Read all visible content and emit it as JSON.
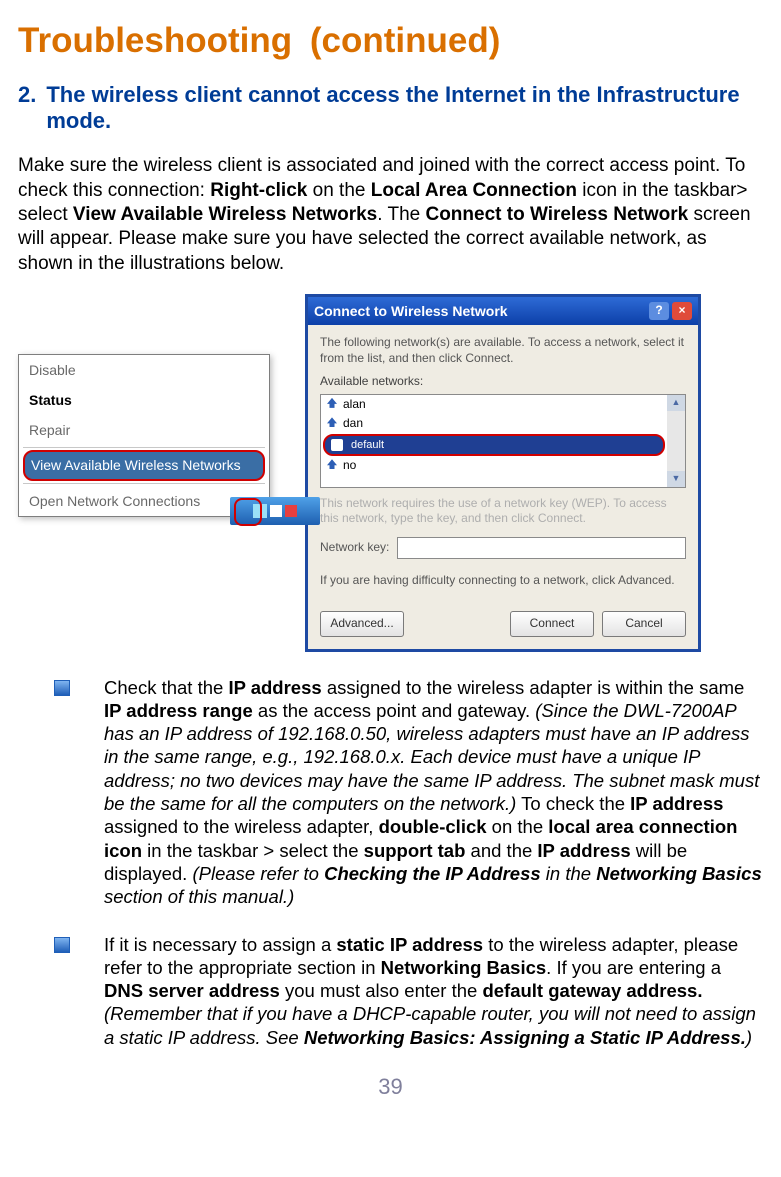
{
  "title": "Troubleshooting (continued)",
  "step": {
    "num": "2.",
    "heading": "The wireless client cannot access the Internet in the Infrastructure mode."
  },
  "intro": {
    "t1": "Make sure the wireless client is associated and joined with the correct access point. To check this connection: ",
    "b1": "Right-click",
    "t2": " on the ",
    "b2": "Local Area Connection",
    "t3": " icon in the taskbar> select ",
    "b3": "View Available Wireless Networks",
    "t4": ". The ",
    "b4": "Connect to Wireless Network",
    "t5": " screen will appear. Please make sure you have selected the correct available network, as shown in the illustrations below."
  },
  "context_menu": {
    "items": [
      "Disable",
      "Status",
      "Repair"
    ],
    "highlight": "View Available Wireless Networks",
    "last": "Open Network Connections"
  },
  "dialog": {
    "title": "Connect to Wireless Network",
    "desc": "The following network(s) are available. To access a network, select it from the list, and then click Connect.",
    "avail_label": "Available networks:",
    "networks": [
      "alan",
      "dan"
    ],
    "selected": "default",
    "after": "no",
    "dim": "This network requires the use of a network key (WEP). To access this network, type the key, and then click Connect.",
    "key_label": "Network key:",
    "note": "If you are having difficulty connecting to a network, click Advanced.",
    "buttons": {
      "adv": "Advanced...",
      "connect": "Connect",
      "cancel": "Cancel"
    }
  },
  "bullets": {
    "b1": {
      "p1": "Check that the ",
      "s1": "IP address",
      "p2": " assigned to the wireless adapter is within the same ",
      "s2": "IP address range",
      "p3": " as the access point and gateway. ",
      "i1": "(Since the DWL-7200AP has an IP address of 192.168.0.50, wireless adapters must have an IP address in the same range, e.g., 192.168.0.x.  Each device must have a unique IP address; no two devices may have the same IP address. The subnet mask must be the same for all the computers on the network.)",
      "p4": " To check the ",
      "s3": "IP address",
      "p5": " assigned to the wireless adapter, ",
      "s4": "double-click",
      "p6": " on the ",
      "s5": "local area connection icon",
      "p7": " in the taskbar > select the ",
      "s6": "support tab",
      "p8": " and the ",
      "s7": "IP address",
      "p9": " will be displayed. ",
      "i2a": "(Please refer to ",
      "i2b": "Checking the IP Address",
      "i2c": " in the ",
      "i2d": "Networking Basics",
      "i2e": " section of this manual.)"
    },
    "b2": {
      "p1": "If it is necessary to assign a ",
      "s1": "static IP address",
      "p2": " to the wireless adapter, please refer to the appropriate section in ",
      "s2": "Networking Basics",
      "p3": ". If you are entering a ",
      "s3": "DNS server address",
      "p4": " you must also enter the ",
      "s4": "default gateway address.",
      "p5": " ",
      "i1": "(Remember that if you have a DHCP-capable router, you will not need to assign a static IP address. See  ",
      "i2": "Networking Basics: Assigning a Static IP Address.",
      "i3": ")"
    }
  },
  "page_number": "39"
}
